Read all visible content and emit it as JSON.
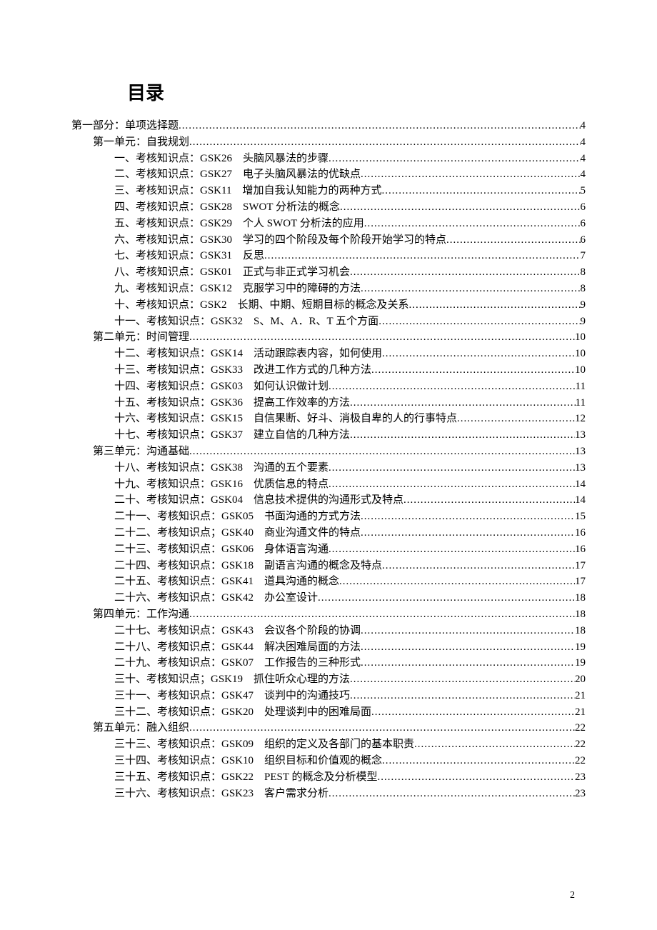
{
  "title": "目录",
  "page_number": "2",
  "entries": [
    {
      "level": 0,
      "label": "第一部分：单项选择题",
      "desc": "",
      "page": "4"
    },
    {
      "level": 1,
      "label": "第一单元：自我规划",
      "desc": "",
      "page": "4"
    },
    {
      "level": 2,
      "label": "一、考核知识点：GSK26",
      "desc": "头脑风暴法的步骤",
      "page": "4"
    },
    {
      "level": 2,
      "label": "二、考核知识点：GSK27",
      "desc": "电子头脑风暴法的优缺点",
      "page": "4"
    },
    {
      "level": 2,
      "label": "三、考核知识点：GSK11",
      "desc": "增加自我认知能力的两种方式",
      "page": "5"
    },
    {
      "level": 2,
      "label": "四、考核知识点：GSK28",
      "desc": "SWOT 分析法的概念",
      "page": "6"
    },
    {
      "level": 2,
      "label": "五、考核知识点：GSK29",
      "desc": "个人 SWOT 分析法的应用",
      "page": "6"
    },
    {
      "level": 2,
      "label": "六、考核知识点：GSK30",
      "desc": "学习的四个阶段及每个阶段开始学习的特点",
      "page": "6"
    },
    {
      "level": 2,
      "label": "七、考核知识点：GSK31",
      "desc": "反思",
      "page": "7"
    },
    {
      "level": 2,
      "label": "八、考核知识点：GSK01",
      "desc": "正式与非正式学习机会",
      "page": "8"
    },
    {
      "level": 2,
      "label": "九、考核知识点：GSK12",
      "desc": "克服学习中的障碍的方法",
      "page": "8"
    },
    {
      "level": 2,
      "label": "十、考核知识点：GSK2",
      "desc": "长期、中期、短期目标的概念及关系",
      "page": "9"
    },
    {
      "level": 2,
      "label": "十一、考核知识点：GSK32",
      "desc": "S、M、A．R、T 五个方面",
      "page": "9"
    },
    {
      "level": 1,
      "label": "第二单元：时间管理",
      "desc": "",
      "page": "10"
    },
    {
      "level": 2,
      "label": "十二、考核知识点：GSK14",
      "desc": "活动跟踪表内容，如何使用",
      "page": "10"
    },
    {
      "level": 2,
      "label": "十三、考核知识点：GSK33",
      "desc": "改进工作方式的几种方法",
      "page": "10"
    },
    {
      "level": 2,
      "label": "十四、考核知识点：GSK03",
      "desc": "如何认识做计划",
      "page": "11"
    },
    {
      "level": 2,
      "label": "十五、考核知识点：GSK36",
      "desc": "提高工作效率的方法",
      "page": "11"
    },
    {
      "level": 2,
      "label": "十六、考核知识点：GSK15",
      "desc": "自信果断、好斗、消极自卑的人的行事特点",
      "page": "12"
    },
    {
      "level": 2,
      "label": "十七、考核知识点：GSK37",
      "desc": "建立自信的几种方法",
      "page": "13"
    },
    {
      "level": 1,
      "label": "第三单元：沟通基础",
      "desc": "",
      "page": "13"
    },
    {
      "level": 2,
      "label": "十八、考核知识点：GSK38",
      "desc": "沟通的五个要素",
      "page": "13"
    },
    {
      "level": 2,
      "label": "十九、考核知识点：GSK16",
      "desc": "优质信息的特点",
      "page": "14"
    },
    {
      "level": 2,
      "label": "二十、考核知识点：GSK04",
      "desc": "信息技术提供的沟通形式及特点",
      "page": "14"
    },
    {
      "level": 2,
      "label": "二十一、考核知识点：GSK05",
      "desc": "书面沟通的方式方法",
      "page": "15"
    },
    {
      "level": 2,
      "label": "二十二、考核知识点；GSK40",
      "desc": "商业沟通文件的特点",
      "page": "16"
    },
    {
      "level": 2,
      "label": "二十三、考核知识点：GSK06",
      "desc": "身体语言沟通",
      "page": "16"
    },
    {
      "level": 2,
      "label": "二十四、考核知识点：GSK18",
      "desc": "副语言沟通的概念及特点",
      "page": "17"
    },
    {
      "level": 2,
      "label": "二十五、考核知识点：GSK41",
      "desc": "道具沟通的概念",
      "page": "17"
    },
    {
      "level": 2,
      "label": "二十六、考核知识点：GSK42",
      "desc": "办公室设计",
      "page": "18"
    },
    {
      "level": 1,
      "label": "第四单元：工作沟通",
      "desc": "",
      "page": "18"
    },
    {
      "level": 2,
      "label": "二十七、考核知识点：GSK43",
      "desc": "会议各个阶段的协调",
      "page": "18"
    },
    {
      "level": 2,
      "label": "二十八、考核知识点：GSK44",
      "desc": "解决困难局面的方法",
      "page": "19"
    },
    {
      "level": 2,
      "label": "二十九、考核知识点：GSK07",
      "desc": "工作报告的三种形式",
      "page": "19"
    },
    {
      "level": 2,
      "label": "三十、考核知识点；GSK19",
      "desc": "抓住听众心理的方法",
      "page": "20"
    },
    {
      "level": 2,
      "label": "三十一、考核知识点：GSK47",
      "desc": "谈判中的沟通技巧",
      "page": "21"
    },
    {
      "level": 2,
      "label": "三十二、考核知识点：GSK20",
      "desc": "处理谈判中的困难局面",
      "page": "21"
    },
    {
      "level": 1,
      "label": "第五单元：融入组织",
      "desc": "",
      "page": "22"
    },
    {
      "level": 2,
      "label": "三十三、考核知识点：GSK09",
      "desc": "组织的定义及各部门的基本职责",
      "page": "22"
    },
    {
      "level": 2,
      "label": "三十四、考核知识点：GSK10",
      "desc": "组织目标和价值观的概念",
      "page": "22"
    },
    {
      "level": 2,
      "label": "三十五、考核知识点：GSK22",
      "desc": "PEST 的概念及分析模型",
      "page": "23"
    },
    {
      "level": 2,
      "label": "三十六、考核知识点：GSK23",
      "desc": "客户需求分析",
      "page": "23"
    }
  ]
}
